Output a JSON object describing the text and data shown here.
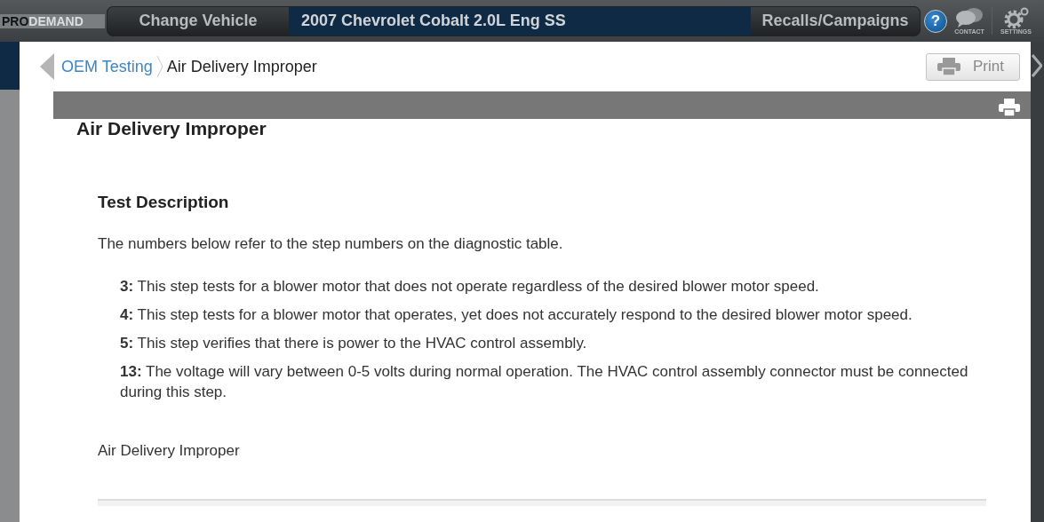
{
  "header": {
    "logo": {
      "prefix": "PRO",
      "name": "DEMAND"
    },
    "change_vehicle": "Change Vehicle",
    "vehicle": "2007 Chevrolet Cobalt 2.0L Eng SS",
    "recalls": "Recalls/Campaigns",
    "help": "?",
    "contact": "CONTACT",
    "settings": "SETTINGS"
  },
  "breadcrumb": [
    {
      "label": "OEM Testing",
      "kind": "link"
    },
    {
      "label": "Air Delivery Improper",
      "kind": "current"
    }
  ],
  "print_button": "Print",
  "document": {
    "title": "Air Delivery Improper",
    "section_title": "Test Description",
    "intro": "The numbers below refer to the step numbers on the diagnostic table.",
    "steps": [
      "**3:** This step tests for a blower motor that does not operate regardless of the desired blower motor speed.",
      "**4:** This step tests for a blower motor that operates, yet does not accurately respond to the desired blower motor speed.",
      "**5:** This step verifies that there is power to the HVAC control assembly.",
      "**13:** The voltage will vary between 0-5 volts during normal operation. The HVAC control assembly connector must be connected during this step."
    ],
    "caption": "Air Delivery Improper"
  }
}
